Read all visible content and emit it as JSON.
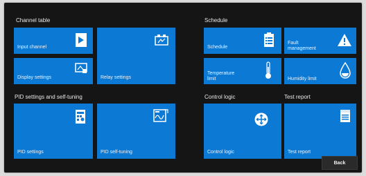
{
  "sections": {
    "channel_table": "Channel table",
    "schedule": "Schedule",
    "pid": "PID settings and self-tuning",
    "control_logic": "Control logic",
    "test_report": "Test report"
  },
  "tiles": {
    "input_channel": "Input channel",
    "display_settings": "Display settings",
    "relay_settings": "Relay settings",
    "schedule": "Schedule",
    "fault_management": "Fault management",
    "temperature_limit": "Temperature limit",
    "humidity_limit": "Humidity limit",
    "pid_settings": "PID settings",
    "pid_self_tuning": "PID self-tuning",
    "control_logic": "Control logic",
    "test_report": "Test report"
  },
  "footer": {
    "back": "Back"
  },
  "icons": {
    "input_channel": "channel-icon",
    "display_settings": "display-settings-icon",
    "relay_settings": "relay-icon",
    "schedule": "schedule-list-icon",
    "fault_management": "warning-icon",
    "temperature_limit": "thermometer-icon",
    "humidity_limit": "droplet-icon",
    "pid_settings": "pid-settings-icon",
    "pid_self_tuning": "pid-tuning-icon",
    "control_logic": "control-logic-icon",
    "test_report": "report-icon"
  },
  "colors": {
    "tile": "#0c79d4",
    "background": "#151515"
  }
}
